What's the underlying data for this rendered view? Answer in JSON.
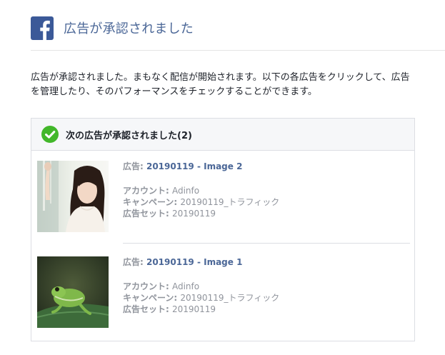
{
  "header": {
    "title": "広告が承認されました",
    "logo_icon": "facebook-logo-icon"
  },
  "intro": {
    "line1": "広告が承認されました。まもなく配信が開始されます。以下の各広告をクリックして、広告",
    "line2": "を管理したり、そのパフォーマンスをチェックすることができます。"
  },
  "card": {
    "title": "次の広告が承認されました(2)",
    "icon": "check-circle-icon",
    "ads": [
      {
        "ad_label": "広告: ",
        "ad_name": "20190119 - Image 2",
        "account_label": "アカウント: ",
        "account": "Adinfo",
        "campaign_label": "キャンペーン: ",
        "campaign": "20190119_トラフィック",
        "adset_label": "広告セット: ",
        "adset": "20190119",
        "thumbnail": "woman-photo"
      },
      {
        "ad_label": "広告: ",
        "ad_name": "20190119 - Image 1",
        "account_label": "アカウント: ",
        "account": "Adinfo",
        "campaign_label": "キャンペーン: ",
        "campaign": "20190119_トラフィック",
        "adset_label": "広告セット: ",
        "adset": "20190119",
        "thumbnail": "frog-photo"
      }
    ]
  },
  "colors": {
    "brand": "#3b5998",
    "title_text": "#4b6797",
    "link": "#4b6797",
    "muted": "#90949c",
    "check": "#42b72a"
  }
}
